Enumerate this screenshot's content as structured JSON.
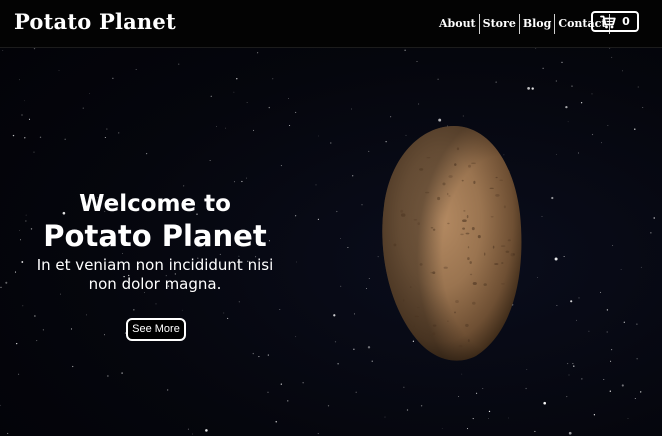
{
  "header": {
    "brand": "Potato Planet",
    "nav": [
      {
        "label": "About"
      },
      {
        "label": "Store"
      },
      {
        "label": "Blog"
      },
      {
        "label": "Contact"
      }
    ],
    "cart": {
      "icon": "cart-icon",
      "count": "0"
    }
  },
  "hero": {
    "welcome": "Welcome to",
    "title": "Potato Planet",
    "description": "In et veniam non incididunt nisi non dolor magna.",
    "button_label": "See More",
    "image": "potato-planet-image"
  },
  "colors": {
    "background": "#000000",
    "text": "#ffffff",
    "potato": "#9a7450"
  }
}
